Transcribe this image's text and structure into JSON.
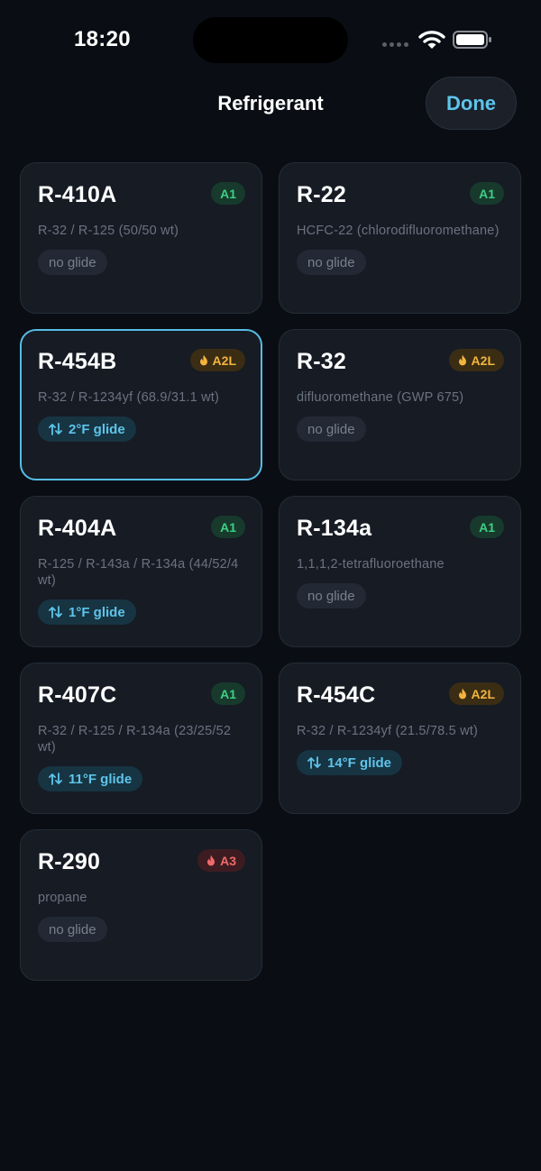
{
  "status": {
    "time": "18:20"
  },
  "nav": {
    "title": "Refrigerant",
    "done_label": "Done"
  },
  "colors": {
    "accent": "#5ec4ea",
    "a1": "#3ecf85",
    "a2l": "#f3b43f",
    "a3": "#f06a6a"
  },
  "refrigerants": [
    {
      "name": "R-410A",
      "safety": "A1",
      "desc": "R-32 / R-125 (50/50 wt)",
      "glide": "no glide",
      "has_glide": false,
      "flammable": false,
      "selected": false
    },
    {
      "name": "R-22",
      "safety": "A1",
      "desc": "HCFC-22 (chlorodifluoromethane)",
      "glide": "no glide",
      "has_glide": false,
      "flammable": false,
      "selected": false
    },
    {
      "name": "R-454B",
      "safety": "A2L",
      "desc": "R-32 / R-1234yf (68.9/31.1 wt)",
      "glide": "2°F glide",
      "has_glide": true,
      "flammable": true,
      "selected": true
    },
    {
      "name": "R-32",
      "safety": "A2L",
      "desc": "difluoromethane (GWP 675)",
      "glide": "no glide",
      "has_glide": false,
      "flammable": true,
      "selected": false
    },
    {
      "name": "R-404A",
      "safety": "A1",
      "desc": "R-125 / R-143a / R-134a (44/52/4 wt)",
      "glide": "1°F glide",
      "has_glide": true,
      "flammable": false,
      "selected": false
    },
    {
      "name": "R-134a",
      "safety": "A1",
      "desc": "1,1,1,2-tetrafluoroethane",
      "glide": "no glide",
      "has_glide": false,
      "flammable": false,
      "selected": false
    },
    {
      "name": "R-407C",
      "safety": "A1",
      "desc": "R-32 / R-125 / R-134a (23/25/52 wt)",
      "glide": "11°F glide",
      "has_glide": true,
      "flammable": false,
      "selected": false
    },
    {
      "name": "R-454C",
      "safety": "A2L",
      "desc": "R-32 / R-1234yf (21.5/78.5 wt)",
      "glide": "14°F glide",
      "has_glide": true,
      "flammable": true,
      "selected": false
    },
    {
      "name": "R-290",
      "safety": "A3",
      "desc": "propane",
      "glide": "no glide",
      "has_glide": false,
      "flammable": true,
      "selected": false
    }
  ]
}
